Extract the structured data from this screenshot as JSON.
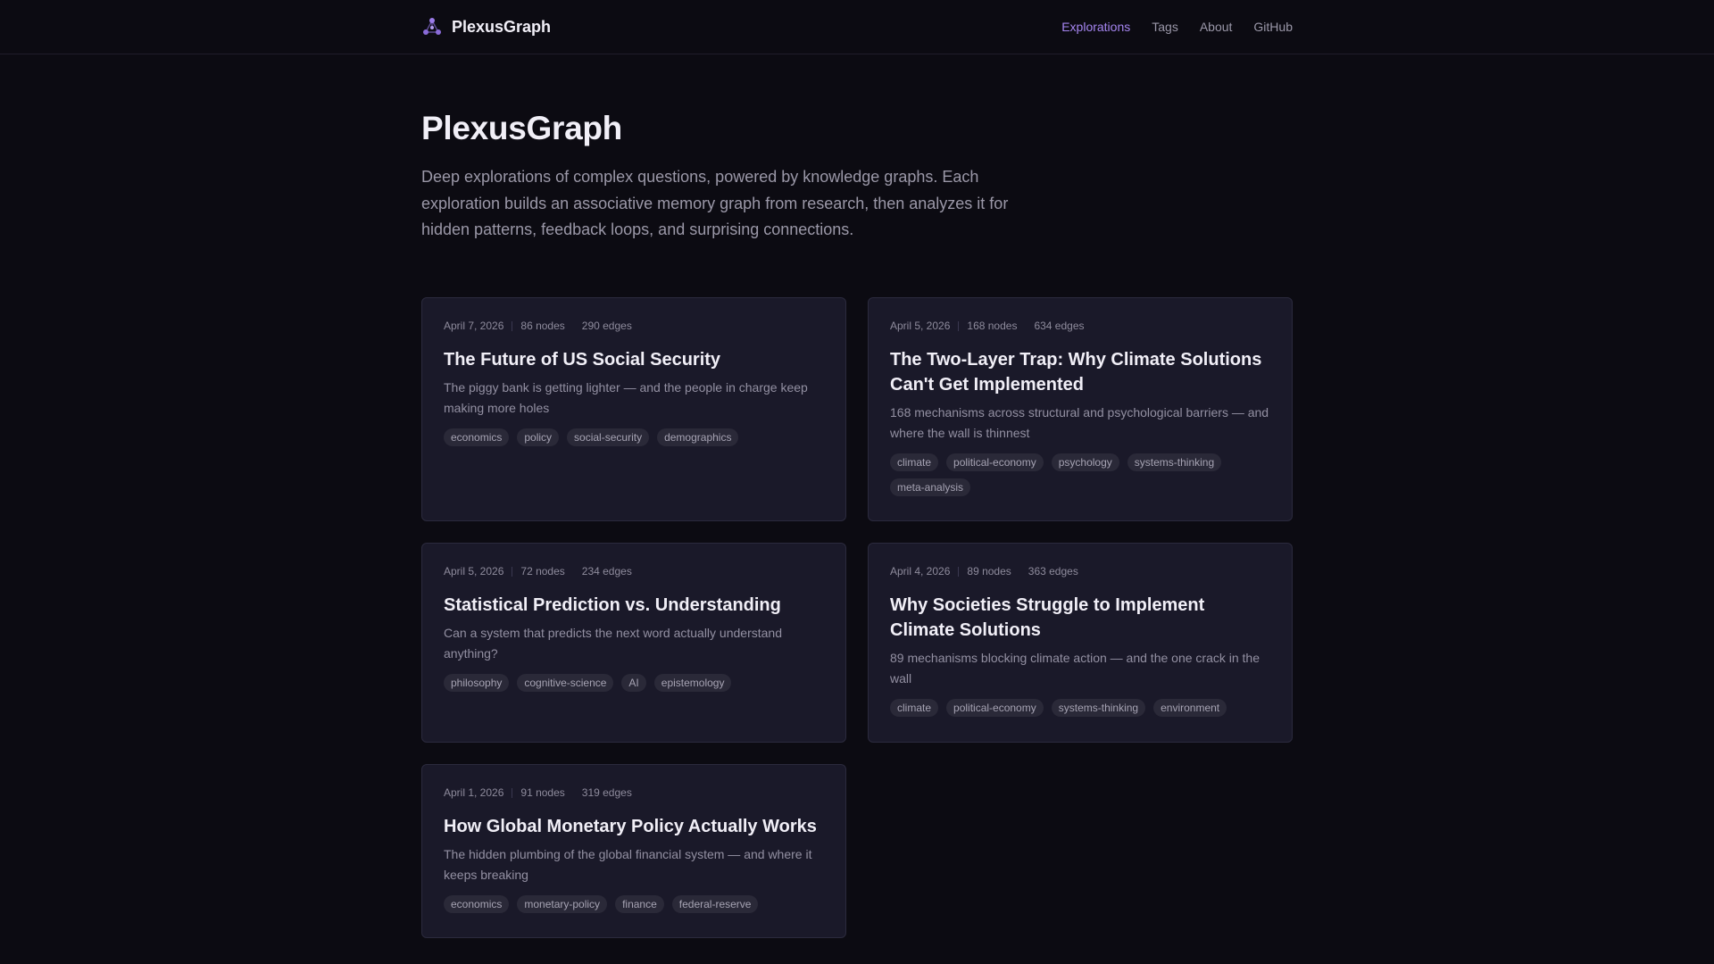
{
  "header": {
    "brand": "PlexusGraph",
    "nav": [
      {
        "label": "Explorations",
        "active": true
      },
      {
        "label": "Tags",
        "active": false
      },
      {
        "label": "About",
        "active": false
      },
      {
        "label": "GitHub",
        "active": false
      }
    ]
  },
  "hero": {
    "title": "PlexusGraph",
    "description": "Deep explorations of complex questions, powered by knowledge graphs. Each exploration builds an associative memory graph from research, then analyzes it for hidden patterns, feedback loops, and surprising connections."
  },
  "explorations": [
    {
      "date": "April 7, 2026",
      "nodes": "86 nodes",
      "edges": "290 edges",
      "title": "The Future of US Social Security",
      "subtitle": "The piggy bank is getting lighter — and the people in charge keep making more holes",
      "tags": [
        "economics",
        "policy",
        "social-security",
        "demographics"
      ]
    },
    {
      "date": "April 5, 2026",
      "nodes": "168 nodes",
      "edges": "634 edges",
      "title": "The Two-Layer Trap: Why Climate Solutions Can't Get Implemented",
      "subtitle": "168 mechanisms across structural and psychological barriers — and where the wall is thinnest",
      "tags": [
        "climate",
        "political-economy",
        "psychology",
        "systems-thinking",
        "meta-analysis"
      ]
    },
    {
      "date": "April 5, 2026",
      "nodes": "72 nodes",
      "edges": "234 edges",
      "title": "Statistical Prediction vs. Understanding",
      "subtitle": "Can a system that predicts the next word actually understand anything?",
      "tags": [
        "philosophy",
        "cognitive-science",
        "AI",
        "epistemology"
      ]
    },
    {
      "date": "April 4, 2026",
      "nodes": "89 nodes",
      "edges": "363 edges",
      "title": "Why Societies Struggle to Implement Climate Solutions",
      "subtitle": "89 mechanisms blocking climate action — and the one crack in the wall",
      "tags": [
        "climate",
        "political-economy",
        "systems-thinking",
        "environment"
      ]
    },
    {
      "date": "April 1, 2026",
      "nodes": "91 nodes",
      "edges": "319 edges",
      "title": "How Global Monetary Policy Actually Works",
      "subtitle": "The hidden plumbing of the global financial system — and where it keeps breaking",
      "tags": [
        "economics",
        "monetary-policy",
        "finance",
        "federal-reserve"
      ]
    }
  ]
}
